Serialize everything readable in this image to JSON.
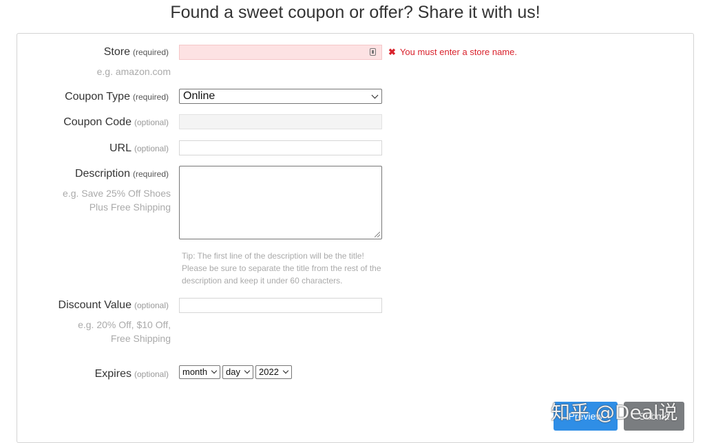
{
  "page": {
    "title": "Found a sweet coupon or offer? Share it with us!"
  },
  "form": {
    "store": {
      "label": "Store",
      "tag": "(required)",
      "hint": "e.g. amazon.com",
      "value": "",
      "error": "You must enter a store name."
    },
    "coupon_type": {
      "label": "Coupon Type",
      "tag": "(required)",
      "selected": "Online"
    },
    "coupon_code": {
      "label": "Coupon Code",
      "tag": "(optional)",
      "value": ""
    },
    "url": {
      "label": "URL",
      "tag": "(optional)",
      "value": ""
    },
    "description": {
      "label": "Description",
      "tag": "(required)",
      "hint_line1": "e.g. Save 25% Off Shoes",
      "hint_line2": "Plus Free Shipping",
      "tip": "Tip: The first line of the description will be the title! Please be sure to separate the title from the rest of the description and keep it under 60 characters.",
      "value": ""
    },
    "discount_value": {
      "label": "Discount Value",
      "tag": "(optional)",
      "hint_line1": "e.g. 20% Off, $10 Off,",
      "hint_line2": "Free Shipping",
      "value": ""
    },
    "expires": {
      "label": "Expires",
      "tag": "(optional)",
      "month": "month",
      "day": "day",
      "year": "2022"
    }
  },
  "buttons": {
    "preview": "Preview",
    "submit": "Submit"
  },
  "watermark": "知乎 @Deal说",
  "colors": {
    "error": "#d9232d",
    "primary": "#2f8ee6",
    "secondary": "#7a7d80"
  }
}
